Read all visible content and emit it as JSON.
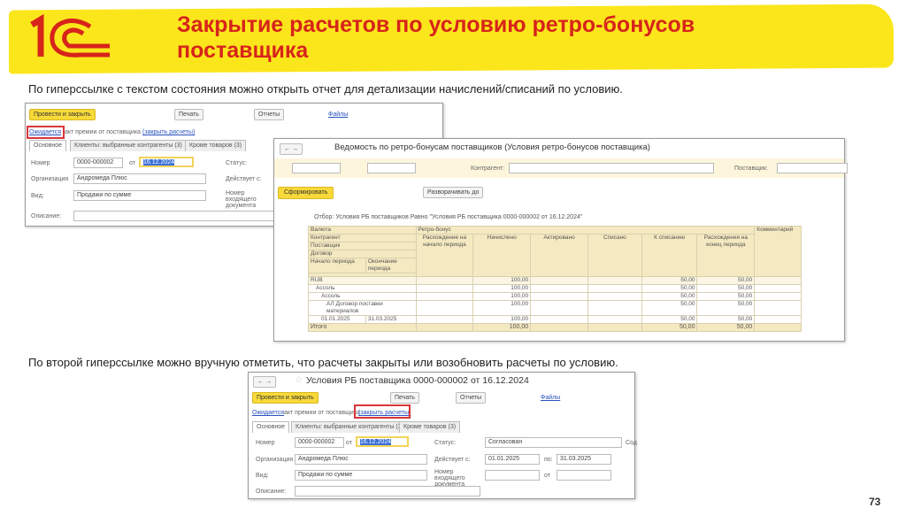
{
  "slide": {
    "title_line1": "Закрытие расчетов по условию ретро-бонусов",
    "title_line2": "поставщика",
    "logo_text": "1С",
    "para1": "По гиперссылке с текстом состояния можно открыть отчет для детализации начислений/списаний по условию.",
    "para2": "По второй гиперссылке можно вручную отметить, что расчеты закрыты или возобновить расчеты по условию.",
    "page_number": "73"
  },
  "form": {
    "title": "Условия РБ поставщика 0000-000002 от 16.12.2024",
    "post_close": "Провести и закрыть",
    "print": "Печать",
    "reports": "Отчеты",
    "files": "Файлы",
    "state_link": "Ожидается",
    "state_text": "акт премии от поставщика",
    "close_link": "(закрыть расчеты)",
    "tabs": [
      "Основное",
      "Клиенты: выбранные контрагенты (3)",
      "Кроме товаров (3)"
    ],
    "number_label": "Номер",
    "number": "0000-000002",
    "from_label": "от",
    "date": "16.12.2024",
    "status_label": "Статус:",
    "status": "Согласован",
    "org_label": "Организация",
    "org": "Андромеда Плюс",
    "active_label": "Действует с:",
    "active_from": "01.01.2025",
    "to_label": "по:",
    "active_to": "31.03.2025",
    "kind_label": "Вид:",
    "kind": "Продажи по сумме",
    "incoming_label": "Номер входящего документа",
    "desc_label": "Описание:",
    "extra": "Сод"
  },
  "report": {
    "title": "Ведомость по ретро-бонусам поставщиков (Условия ретро-бонусов поставщика)",
    "contractor_label": "Контрагент:",
    "supplier_label": "Поставщик:",
    "generate": "Сформировать",
    "expand": "Разворачивать до",
    "filter": "Отбор:   Условия РБ поставщиков Равно \"Условия РБ поставщика 0000-000002 от 16.12.2024\"",
    "group_headers": [
      "Валюта",
      "Контрагент",
      "Поставщик",
      "Договор"
    ],
    "period_start": "Начало периода",
    "period_end": "Окончание периода",
    "retro": "Ретро-бонус",
    "columns": [
      "Расхождение на начало периода",
      "Начислено",
      "Актировано",
      "Списано",
      "К списанию",
      "Расхождения на конец периода",
      "Комментарий"
    ],
    "rows": [
      {
        "name": "RUB",
        "accrued": "100,00",
        "to_write": "50,00",
        "end": "50,00"
      },
      {
        "name": "Ассоль",
        "accrued": "100,00",
        "to_write": "50,00",
        "end": "50,00"
      },
      {
        "name": "Ассоль",
        "accrued": "100,00",
        "to_write": "50,00",
        "end": "50,00"
      },
      {
        "name": "АЛ Договор поставки материалов",
        "accrued": "100,00",
        "to_write": "50,00",
        "end": "50,00"
      },
      {
        "name": "01.01.2025",
        "name2": "31.03.2025",
        "accrued": "100,00",
        "to_write": "50,00",
        "end": "50,00"
      }
    ],
    "total": {
      "name": "Итого",
      "accrued": "100,00",
      "to_write": "50,00",
      "end": "50,00"
    }
  }
}
